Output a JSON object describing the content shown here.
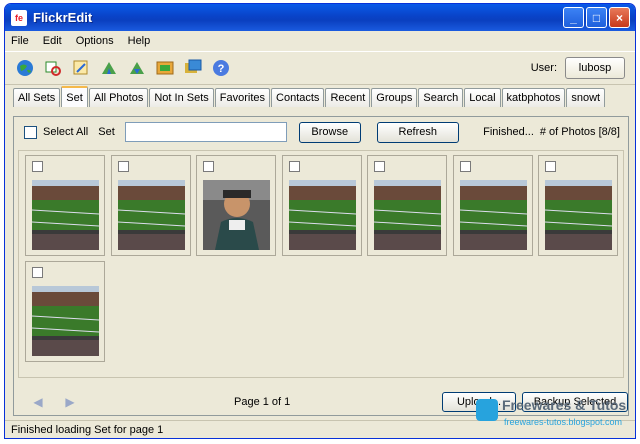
{
  "window": {
    "title": "FlickrEdit",
    "icon_text": "fe"
  },
  "menu": [
    "File",
    "Edit",
    "Options",
    "Help"
  ],
  "toolbar": {
    "icons": [
      "globe-icon",
      "filter-icon",
      "edit-icon",
      "tree-up-icon",
      "tree-down-icon",
      "photo-upload-icon",
      "photos-icon",
      "help-icon"
    ],
    "user_label": "User:",
    "user_name": "lubosp"
  },
  "tabs": [
    "All Sets",
    "Set",
    "All Photos",
    "Not In Sets",
    "Favorites",
    "Contacts",
    "Recent",
    "Groups",
    "Search",
    "Local",
    "katbphotos",
    "snowt"
  ],
  "active_tab": "Set",
  "controls": {
    "select_all_label": "Select All",
    "set_label": "Set",
    "set_value": "",
    "browse_label": "Browse",
    "refresh_label": "Refresh",
    "status": "Finished...",
    "photo_count": "# of Photos [8/8]"
  },
  "thumbnails": [
    {
      "scene": "stadium"
    },
    {
      "scene": "stadium"
    },
    {
      "scene": "person"
    },
    {
      "scene": "stadium"
    },
    {
      "scene": "stadium"
    },
    {
      "scene": "stadium"
    },
    {
      "scene": "stadium"
    },
    {
      "scene": "stadium"
    }
  ],
  "footer": {
    "page_text": "Page 1 of 1",
    "upload_label": "Upload...",
    "backup_label": "Backup Selected"
  },
  "statusbar": {
    "text": "Finished loading Set for page 1"
  },
  "watermark": {
    "title": "Freewares & Tutos",
    "subtitle": "freewares-tutos.blogspot.com"
  },
  "colors": {
    "titlebar": "#0a4fd6",
    "accent_tab": "#f5b94b",
    "field": "#3a7a2a"
  }
}
